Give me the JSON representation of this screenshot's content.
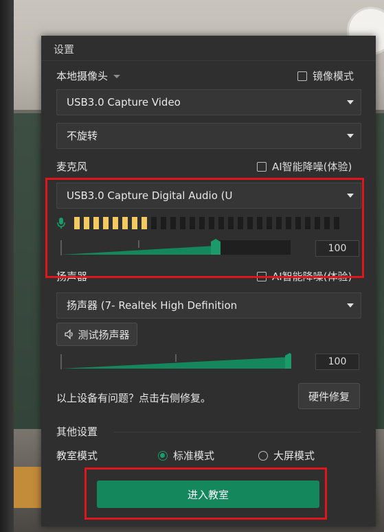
{
  "dialog": {
    "title": "设置"
  },
  "camera": {
    "label": "本地摄像头",
    "mirror_label": "镜像模式",
    "device": "USB3.0 Capture Video",
    "rotation": "不旋转"
  },
  "microphone": {
    "label": "麦克风",
    "ai_noise_label": "AI智能降噪(体验)",
    "device": "USB3.0 Capture Digital Audio (U",
    "level_segments_on": 8,
    "level_segments_total": 28,
    "volume": "100"
  },
  "speaker": {
    "label": "扬声器",
    "ai_noise_label": "AI智能降噪(体验)",
    "device": "扬声器 (7- Realtek High Definition",
    "test_button": "测试扬声器",
    "volume": "100"
  },
  "repair": {
    "hint": "以上设备有问题？点击右侧修复。",
    "button": "硬件修复"
  },
  "other": {
    "label": "其他设置",
    "classroom_mode_label": "教室模式",
    "mode_standard": "标准模式",
    "mode_bigscreen": "大屏模式",
    "selected_mode": "标准模式"
  },
  "enter_button": "进入教室",
  "colors": {
    "accent": "#14875d",
    "meter_on": "#f3ca62",
    "highlight": "#e0161d"
  },
  "icons": [
    "mic-icon",
    "speaker-icon",
    "chevron-down-icon",
    "clock-icon"
  ]
}
